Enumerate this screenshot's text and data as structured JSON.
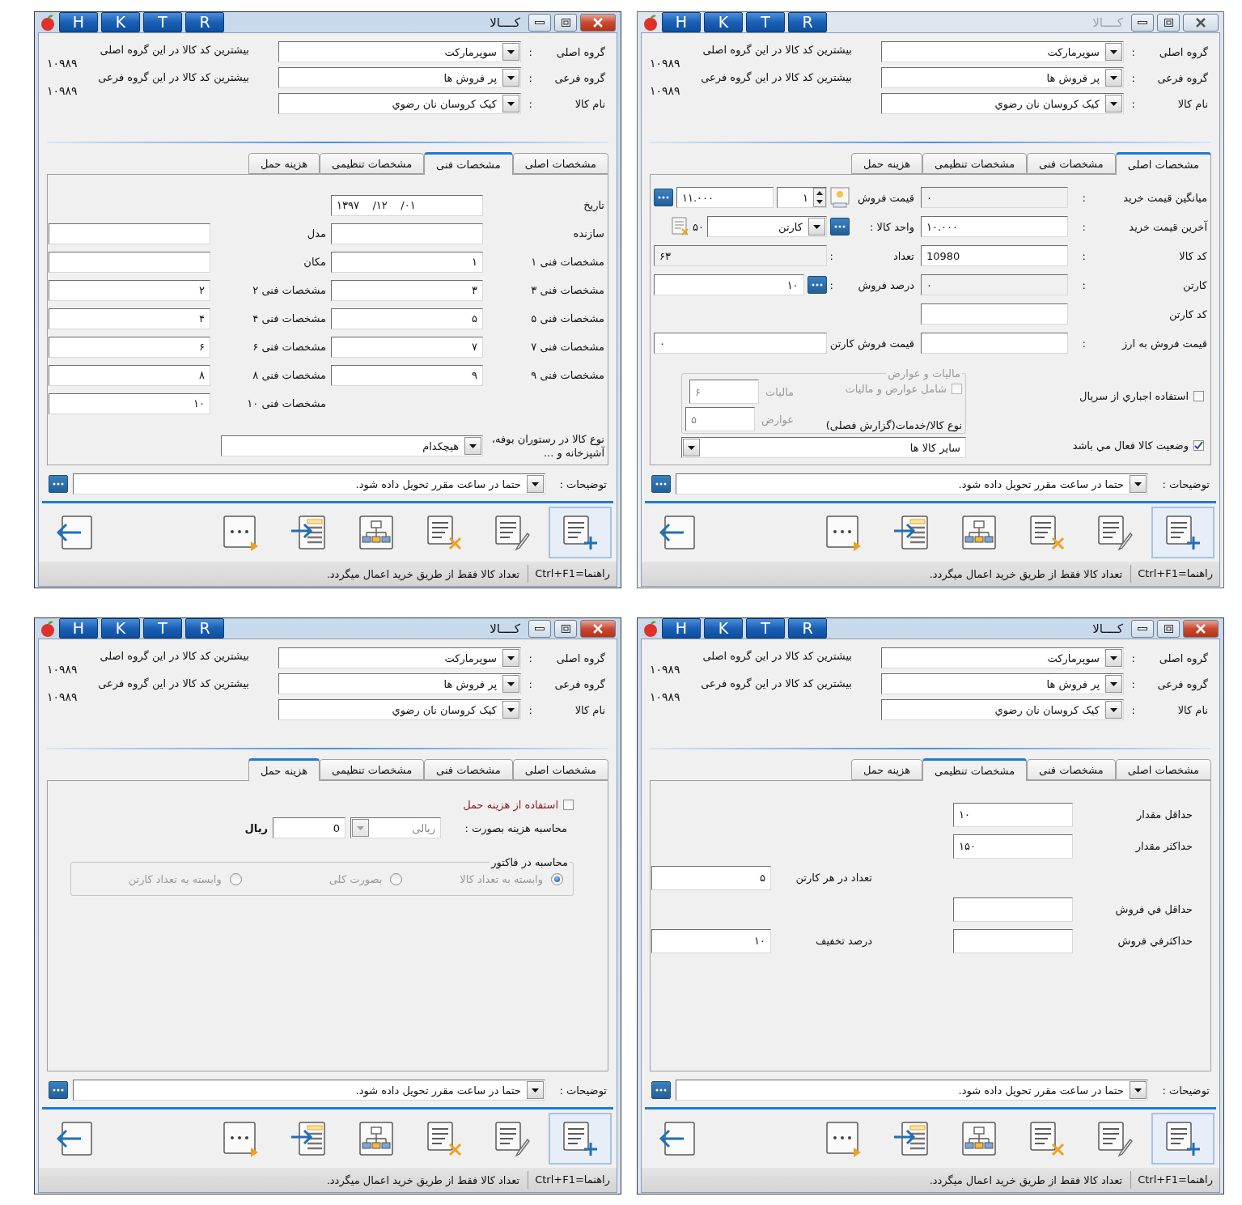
{
  "windows": [
    {
      "title": "کــــالا",
      "active": false,
      "shortcuts": [
        "R",
        "T",
        "K",
        "H"
      ],
      "header": {
        "fields": [
          {
            "label": "گروه اصلی",
            "colon": ":",
            "value": "سوپرمارکت"
          },
          {
            "label": "گروه فرعی",
            "colon": ":",
            "value": "پر فروش ها"
          },
          {
            "label": "نام کالا",
            "colon": ":",
            "value": "کیک کروسان نان رضوي"
          }
        ],
        "notes": [
          {
            "label": "بیشترین کد کالا در این گروه اصلی",
            "value": "۱۰۹۸۹"
          },
          {
            "label": "بیشترین کد کالا در این گروه فرعی",
            "value": "۱۰۹۸۹"
          }
        ]
      },
      "tabs": [
        {
          "label": "مشخصات اصلی",
          "selected": true
        },
        {
          "label": "مشخصات فنی",
          "selected": false
        },
        {
          "label": "مشخصات تنظیمی",
          "selected": false
        },
        {
          "label": "هزینه حمل",
          "selected": false
        }
      ],
      "panel": {
        "kind": "main",
        "rows": [
          {
            "label": "میانگین قیمت خرید",
            "colon": ":",
            "field": {
              "value": "۰",
              "disabled": true
            },
            "side": {
              "kind": "price",
              "label": "قیمت فروش",
              "spin": "۱",
              "value": "۱۱.۰۰۰"
            }
          },
          {
            "label": "آخرین قیمت خرید",
            "colon": ":",
            "field": {
              "value": "۱۰.۰۰۰",
              "disabled": false
            },
            "side": {
              "kind": "unit",
              "label": "واحد کالا :",
              "value": "کارتن",
              "count": "۵۰"
            }
          },
          {
            "label": "کد کالا",
            "colon": ":",
            "field": {
              "value": "10980",
              "disabled": false
            },
            "side": {
              "kind": "field",
              "label": "تعداد",
              "colon": ":",
              "value": "۶۳",
              "disabled": true
            }
          },
          {
            "label": "کارتن",
            "colon": ":",
            "field": {
              "value": "۰",
              "disabled": true
            },
            "side": {
              "kind": "field",
              "label": "درصد فروش",
              "colon": ":",
              "value": "۱۰",
              "disabled": false,
              "more": true
            }
          },
          {
            "label": "کد کارتن",
            "field": {
              "disabled": false
            }
          },
          {
            "label": "قیمت فروش به ارز",
            "colon": ":",
            "field": {
              "disabled": false
            },
            "side": {
              "kind": "field",
              "label": "قیمت فروش کارتن",
              "value": "۰",
              "disabled": false
            }
          }
        ],
        "tax": {
          "title": "مالیات و عوارض",
          "disabled": true,
          "fields": [
            {
              "label": "مالیات",
              "value": "۶"
            },
            {
              "label": "عوارض",
              "value": "۵"
            }
          ],
          "checkbox": {
            "label": "شامل عوارض و مالیات",
            "checked": false
          },
          "type_label": "نوع کالا/خدمات(گزارش فصلی)"
        },
        "type_select": {
          "value": "سایر کالا ها"
        },
        "checks": [
          {
            "label": "استفاده اجباري از سريال",
            "checked": false
          },
          {
            "label": "وضعيت کالا فعال مي باشد",
            "checked": true
          }
        ]
      },
      "description": {
        "label": "توضیحات :",
        "value": "حتما در ساعت مقرر تحویل داده شود."
      },
      "toolbar": [
        {
          "kind": "add",
          "focused": true
        },
        {
          "kind": "edit",
          "focused": false
        },
        {
          "kind": "delete",
          "focused": false
        },
        {
          "kind": "tree",
          "focused": false
        },
        {
          "kind": "import",
          "focused": false
        },
        {
          "kind": "more",
          "focused": false
        },
        {
          "kind": "back",
          "focused": false
        }
      ],
      "status": {
        "hint": "راهنما=Ctrl+F1",
        "message": "تعداد کالا فقط از طریق خرید اعمال میگردد."
      }
    },
    {
      "title": "کــــالا",
      "active": true,
      "shortcuts": [
        "R",
        "T",
        "K",
        "H"
      ],
      "header": {
        "fields": [
          {
            "label": "گروه اصلی",
            "colon": ":",
            "value": "سوپرمارکت"
          },
          {
            "label": "گروه فرعی",
            "colon": ":",
            "value": "پر فروش ها"
          },
          {
            "label": "نام کالا",
            "colon": ":",
            "value": "کیک کروسان نان رضوي"
          }
        ],
        "notes": [
          {
            "label": "بیشترین کد کالا در این گروه اصلی",
            "value": "۱۰۹۸۹"
          },
          {
            "label": "بیشترین کد کالا در این گروه فرعی",
            "value": "۱۰۹۸۹"
          }
        ]
      },
      "tabs": [
        {
          "label": "مشخصات اصلی",
          "selected": false
        },
        {
          "label": "مشخصات فنی",
          "selected": true
        },
        {
          "label": "مشخصات تنظیمی",
          "selected": false
        },
        {
          "label": "هزینه حمل",
          "selected": false
        }
      ],
      "panel": {
        "kind": "technical",
        "rows": [
          {
            "main": {
              "kind": "date",
              "label": "تاریخ",
              "value": "۱۳۹۷    /۱۲    /۰۱"
            }
          },
          {
            "main": {
              "label": "سازنده"
            },
            "side": {
              "label": "مدل"
            }
          },
          {
            "main": {
              "label": "مشخصات فنی ۱",
              "value": "۱"
            },
            "side": {
              "label": "مکان"
            }
          },
          {
            "main": {
              "label": "مشخصات فنی ۳",
              "value": "۳"
            },
            "side": {
              "label": "مشخصات فنی ۲",
              "value": "۲"
            }
          },
          {
            "main": {
              "label": "مشخصات فنی ۵",
              "value": "۵"
            },
            "side": {
              "label": "مشخصات فنی ۴",
              "value": "۴"
            }
          },
          {
            "main": {
              "label": "مشخصات فنی ۷",
              "value": "۷"
            },
            "side": {
              "label": "مشخصات فنی ۶",
              "value": "۶"
            }
          },
          {
            "main": {
              "label": "مشخصات فنی ۹",
              "value": "۹"
            },
            "side": {
              "label": "مشخصات فنی ۸",
              "value": "۸"
            }
          },
          {
            "side": {
              "label": "مشخصات فنی ۱۰",
              "value": "۱۰"
            }
          }
        ],
        "restaurant": {
          "label": "نوع کالا در رستوران بوفه، آشپزخانه و ...",
          "value": "هیچکدام"
        }
      },
      "description": {
        "label": "توضیحات :",
        "value": "حتما در ساعت مقرر تحویل داده شود."
      },
      "toolbar": [
        {
          "kind": "add",
          "focused": true
        },
        {
          "kind": "edit",
          "focused": false
        },
        {
          "kind": "delete",
          "focused": false
        },
        {
          "kind": "tree",
          "focused": false
        },
        {
          "kind": "import",
          "focused": false
        },
        {
          "kind": "more",
          "focused": false
        },
        {
          "kind": "back",
          "focused": false
        }
      ],
      "status": {
        "hint": "راهنما=Ctrl+F1",
        "message": "تعداد کالا فقط از طریق خرید اعمال میگردد."
      }
    },
    {
      "title": "کــــالا",
      "active": true,
      "shortcuts": [
        "R",
        "T",
        "K",
        "H"
      ],
      "header": {
        "fields": [
          {
            "label": "گروه اصلی",
            "colon": ":",
            "value": "سوپرمارکت"
          },
          {
            "label": "گروه فرعی",
            "colon": ":",
            "value": "پر فروش ها"
          },
          {
            "label": "نام کالا",
            "colon": ":",
            "value": "کیک کروسان نان رضوي"
          }
        ],
        "notes": [
          {
            "label": "بیشترین کد کالا در این گروه اصلی",
            "value": "۱۰۹۸۹"
          },
          {
            "label": "بیشترین کد کالا در این گروه فرعی",
            "value": "۱۰۹۸۹"
          }
        ]
      },
      "tabs": [
        {
          "label": "مشخصات اصلی",
          "selected": false
        },
        {
          "label": "مشخصات فنی",
          "selected": false
        },
        {
          "label": "مشخصات تنظیمی",
          "selected": true
        },
        {
          "label": "هزینه حمل",
          "selected": false
        }
      ],
      "panel": {
        "kind": "settings",
        "rows": [
          {
            "main": {
              "label": "حداقل مقدار",
              "value": "۱۰"
            }
          },
          {
            "main": {
              "label": "حداکثر مقدار",
              "value": "۱۵۰"
            }
          },
          {
            "side": {
              "label": "تعداد در هر کارتن",
              "value": "۵"
            }
          },
          {
            "main": {
              "label": "حداقل في فروش"
            }
          },
          {
            "main": {
              "label": "حداکثرفي فروش"
            },
            "side": {
              "label": "درصد تخفیف",
              "value": "۱۰"
            }
          }
        ]
      },
      "description": {
        "label": "توضیحات :",
        "value": "حتما در ساعت مقرر تحویل داده شود."
      },
      "toolbar": [
        {
          "kind": "add",
          "focused": true
        },
        {
          "kind": "edit",
          "focused": false
        },
        {
          "kind": "delete",
          "focused": false
        },
        {
          "kind": "tree",
          "focused": false
        },
        {
          "kind": "import",
          "focused": false
        },
        {
          "kind": "more",
          "focused": false
        },
        {
          "kind": "back",
          "focused": false
        }
      ],
      "status": {
        "hint": "راهنما=Ctrl+F1",
        "message": "تعداد کالا فقط از طریق خرید اعمال میگردد."
      }
    },
    {
      "title": "کــــالا",
      "active": true,
      "shortcuts": [
        "R",
        "T",
        "K",
        "H"
      ],
      "header": {
        "fields": [
          {
            "label": "گروه اصلی",
            "colon": ":",
            "value": "سوپرمارکت"
          },
          {
            "label": "گروه فرعی",
            "colon": ":",
            "value": "پر فروش ها"
          },
          {
            "label": "نام کالا",
            "colon": ":",
            "value": "کیک کروسان نان رضوي"
          }
        ],
        "notes": [
          {
            "label": "بیشترین کد کالا در این گروه اصلی",
            "value": "۱۰۹۸۹"
          },
          {
            "label": "بیشترین کد کالا در این گروه فرعی",
            "value": "۱۰۹۸۹"
          }
        ]
      },
      "tabs": [
        {
          "label": "مشخصات اصلی",
          "selected": false
        },
        {
          "label": "مشخصات فنی",
          "selected": false
        },
        {
          "label": "مشخصات تنظیمی",
          "selected": false
        },
        {
          "label": "هزینه حمل",
          "selected": true
        }
      ],
      "panel": {
        "kind": "shipping",
        "use": {
          "label": "استفاده از هزینه حمل",
          "checked": false
        },
        "calc": {
          "label": "محاسبه هزینه بصورت :",
          "mode": "ریالی",
          "mode_disabled": true,
          "amount": "0",
          "unit": "ریال"
        },
        "invoice": {
          "title": "محاسبه در فاکتور",
          "disabled": true,
          "options": [
            {
              "label": "وابسته به تعداد کالا",
              "selected": true
            },
            {
              "label": "بصورت کلی",
              "selected": false
            },
            {
              "label": "وابسته به تعداد کارتن",
              "selected": false
            }
          ]
        }
      },
      "description": {
        "label": "توضیحات :",
        "value": "حتما در ساعت مقرر تحویل داده شود."
      },
      "toolbar": [
        {
          "kind": "add",
          "focused": true
        },
        {
          "kind": "edit",
          "focused": false
        },
        {
          "kind": "delete",
          "focused": false
        },
        {
          "kind": "tree",
          "focused": false
        },
        {
          "kind": "import",
          "focused": false
        },
        {
          "kind": "more",
          "focused": false
        },
        {
          "kind": "back",
          "focused": false
        }
      ],
      "status": {
        "hint": "راهنما=Ctrl+F1",
        "message": "تعداد کالا فقط از طریق خرید اعمال میگردد."
      }
    }
  ]
}
